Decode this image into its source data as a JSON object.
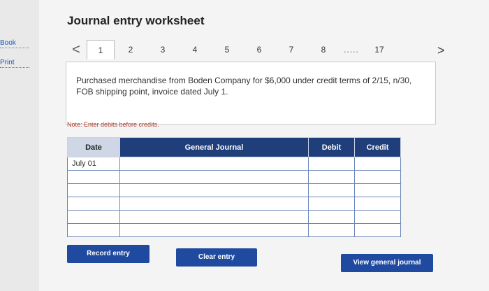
{
  "sidebar": {
    "book_label": "Book",
    "print_label": "Print"
  },
  "header": {
    "title": "Journal entry worksheet"
  },
  "pager": {
    "prev": "<",
    "pages": [
      "1",
      "2",
      "3",
      "4",
      "5",
      "6",
      "7",
      "8"
    ],
    "dots": ".....",
    "last": "17",
    "next": ">"
  },
  "description": "Purchased merchandise from Boden Company for $6,000 under credit terms of 2/15, n/30, FOB shipping point, invoice dated July 1.",
  "note": "Note: Enter debits before credits.",
  "table": {
    "headers": {
      "date": "Date",
      "general_journal": "General Journal",
      "debit": "Debit",
      "credit": "Credit"
    },
    "rows": [
      {
        "date": "July 01"
      },
      {
        "date": ""
      },
      {
        "date": ""
      },
      {
        "date": ""
      },
      {
        "date": ""
      },
      {
        "date": ""
      }
    ]
  },
  "buttons": {
    "record": "Record entry",
    "clear": "Clear entry",
    "view": "View general journal"
  },
  "colors": {
    "primary": "#1f4aa0",
    "header_bg": "#1f3e7a",
    "note": "#b33a2a"
  }
}
